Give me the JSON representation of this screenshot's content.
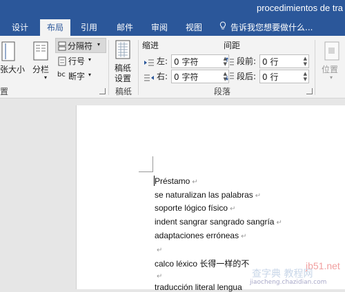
{
  "window": {
    "title": "procedimientos de tra"
  },
  "tabs": [
    {
      "label": "设计"
    },
    {
      "label": "布局"
    },
    {
      "label": "引用"
    },
    {
      "label": "邮件"
    },
    {
      "label": "审阅"
    },
    {
      "label": "视图"
    }
  ],
  "tell_me": {
    "text": "告诉我您想要做什么..."
  },
  "ribbon": {
    "page_setup": {
      "size_label": "纸张大小",
      "columns_label": "分栏",
      "breaks_label": "分隔符",
      "line_numbers_label": "行号",
      "hyphenation_label": "断字",
      "group_label": "置"
    },
    "manuscript": {
      "button_line1": "稿纸",
      "button_line2": "设置",
      "group_label": "稿纸"
    },
    "paragraph": {
      "indent_header": "缩进",
      "spacing_header": "间距",
      "left_label": "左:",
      "right_label": "右:",
      "before_label": "段前:",
      "after_label": "段后:",
      "left_value": "0 字符",
      "right_value": "0 字符",
      "before_value": "0 行",
      "after_value": "0 行",
      "group_label": "段落"
    },
    "arrange": {
      "position_label": "位置"
    }
  },
  "document": {
    "lines": [
      "Préstamo",
      "se naturalizan las palabras",
      "soporte lógico físico",
      "indent sangrar sangrado sangría",
      "adaptaciones erróneas",
      "",
      "calco léxico  长得一样的不",
      "",
      "traducción literal lengua"
    ]
  },
  "watermark": {
    "site": "jb51.net",
    "brand": "查字典 教程网",
    "url": "jiaocheng.chazidian.com"
  },
  "colors": {
    "accent": "#2b579a",
    "ribbon": "#f3f3f3",
    "doc_bg": "#e6e6e6"
  }
}
